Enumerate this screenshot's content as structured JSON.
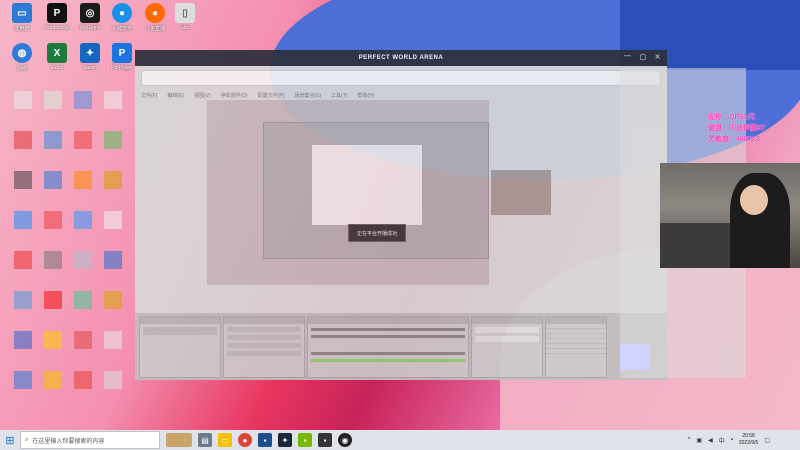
{
  "app": {
    "title": "PERFECT WORLD ARENA",
    "toast": "正在平台开播成功"
  },
  "desktop_icons": [
    {
      "label": "此电脑",
      "glyph": "▭",
      "color": "#2f7ad8"
    },
    {
      "label": "Photoshop",
      "glyph": "P",
      "color": "#111111"
    },
    {
      "label": "WeGame",
      "glyph": "◎",
      "color": "#1b1b1b"
    },
    {
      "label": "火绒安全",
      "glyph": "●",
      "color": "#1a8fe8"
    },
    {
      "label": "斗鱼直播",
      "glyph": "●",
      "color": "#ff6a00"
    },
    {
      "label": "abc",
      "glyph": "▯",
      "color": "#cccccc"
    },
    {
      "label": "网络",
      "glyph": "◍",
      "color": "#2f7ad8"
    },
    {
      "label": "Excel",
      "glyph": "X",
      "color": "#1d7a3c"
    },
    {
      "label": "Steam",
      "glyph": "✦",
      "color": "#1567c0"
    },
    {
      "label": "PotPlayer",
      "glyph": "P",
      "color": "#1b74e0"
    }
  ],
  "overlay": {
    "line1": "昵称：QPS1代",
    "line2": "键盘：闪迪伊藤3T",
    "line3": "灵敏度：400*3.8"
  },
  "taskbar": {
    "search_placeholder": "在这里输入你要搜索的内容",
    "time": "20:58",
    "date": "2022/9/5",
    "ime": "中"
  },
  "menubar": [
    "文件(F)",
    "编辑(E)",
    "视图(V)",
    "停靠部件(D)",
    "配置文件(P)",
    "场景集合(S)",
    "工具(T)",
    "帮助(H)"
  ]
}
